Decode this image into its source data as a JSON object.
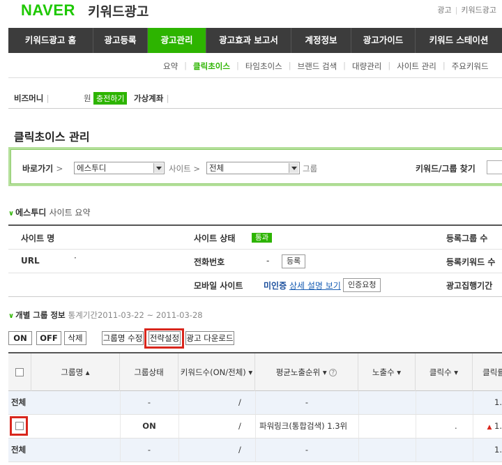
{
  "header": {
    "logo": "NAVER",
    "logo_sub": "키워드광고",
    "links": [
      "광고",
      "키워드광고"
    ]
  },
  "main_nav": [
    {
      "label": "키워드광고 홈",
      "active": false
    },
    {
      "label": "광고등록",
      "active": false
    },
    {
      "label": "광고관리",
      "active": true
    },
    {
      "label": "광고효과 보고서",
      "active": false
    },
    {
      "label": "계정정보",
      "active": false
    },
    {
      "label": "광고가이드",
      "active": false
    },
    {
      "label": "키워드 스테이션",
      "active": false
    }
  ],
  "sub_nav": [
    {
      "label": "요약",
      "active": false
    },
    {
      "label": "클릭초이스",
      "active": true
    },
    {
      "label": "타임초이스",
      "active": false
    },
    {
      "label": "브랜드 검색",
      "active": false
    },
    {
      "label": "대량관리",
      "active": false
    },
    {
      "label": "사이트 관리",
      "active": false
    },
    {
      "label": "주요키워드",
      "active": false
    }
  ],
  "bizmoney": {
    "label": "비즈머니",
    "unit": "원",
    "charge_button": "충전하기",
    "virtual_account": "가상계좌"
  },
  "page_title": "클릭초이스 관리",
  "shortcut": {
    "label": "바로가기",
    "site_select": "에스투디",
    "site_text": "사이트",
    "group_select": "전체",
    "group_text": "그룹",
    "find_label": "키워드/그룹 찾기"
  },
  "summary": {
    "title_site": "에스투디",
    "title_rest": "사이트 요약",
    "site_name_label": "사이트 명",
    "url_label": "URL",
    "url_value": "·",
    "site_status_label": "사이트 상태",
    "site_status_badge": "통과",
    "phone_label": "전화번호",
    "phone_value": "-",
    "phone_register_button": "등록",
    "mobile_site_label": "모바일 사이트",
    "mobile_status": "미인증",
    "mobile_detail_link": "상세 설명 보기",
    "mobile_request_button": "인증요청",
    "reg_group_label": "등록그룹 수",
    "reg_keyword_label": "등록키워드 수",
    "ad_period_label": "광고집행기간"
  },
  "group_info": {
    "title": "개별 그룹 정보",
    "period_label": "통계기간",
    "period_value": "2011-03-22 ~ 2011-03-28"
  },
  "toolbar": {
    "on": "ON",
    "off": "OFF",
    "delete": "삭제",
    "rename": "그룹명 수정",
    "strategy": "전략설정",
    "download": "광고 다운로드"
  },
  "table": {
    "headers": {
      "group_name": "그룹명 ▴",
      "status": "그룹상태",
      "keywords": "키워드수(ON/전체) ▾",
      "avg_rank": "평균노출순위 ▾",
      "impressions": "노출수 ▾",
      "clicks": "클릭수 ▾",
      "ctr": "클릭률"
    },
    "help_icon": "?",
    "rows": [
      {
        "name": "전체",
        "status": "-",
        "keywords": "/",
        "rank": "-",
        "impr": "",
        "clicks": "",
        "ctr": "1."
      },
      {
        "name": "",
        "status": "ON",
        "keywords": "/",
        "rank": "파워링크(통합검색) 1.3위",
        "impr": "",
        "clicks": ".",
        "ctr": "1."
      },
      {
        "name": "전체",
        "status": "-",
        "keywords": "/",
        "rank": "-",
        "impr": "",
        "clicks": "",
        "ctr": "1."
      }
    ]
  },
  "colors": {
    "brand_green": "#1ec800",
    "active_green": "#2db400",
    "nav_dark": "#3c3c3c",
    "highlight_red": "#d9261c"
  }
}
